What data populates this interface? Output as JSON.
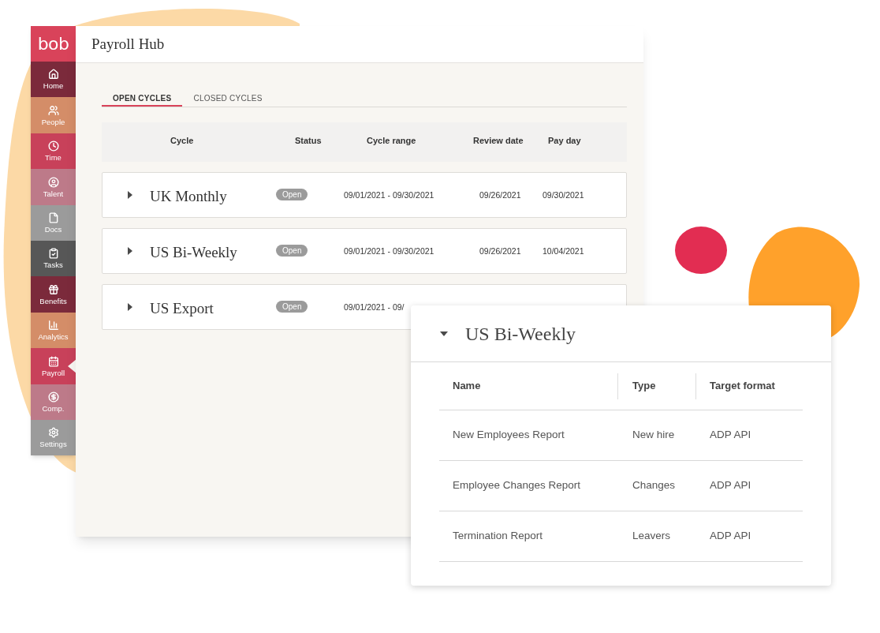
{
  "sidebar": {
    "logo": "bob",
    "items": [
      {
        "label": "Home",
        "color": "#7b2a3b",
        "selected": false
      },
      {
        "label": "People",
        "color": "#d48d68",
        "selected": false
      },
      {
        "label": "Time",
        "color": "#c8415a",
        "selected": false
      },
      {
        "label": "Talent",
        "color": "#bd7a89",
        "selected": false
      },
      {
        "label": "Docs",
        "color": "#9b9b9b",
        "selected": false
      },
      {
        "label": "Tasks",
        "color": "#575757",
        "selected": false
      },
      {
        "label": "Benefits",
        "color": "#7b2a3b",
        "selected": false
      },
      {
        "label": "Analytics",
        "color": "#d48d68",
        "selected": false
      },
      {
        "label": "Payroll",
        "color": "#c8415a",
        "selected": true
      },
      {
        "label": "Comp.",
        "color": "#bd7a89",
        "selected": false
      },
      {
        "label": "Settings",
        "color": "#9b9b9b",
        "selected": false
      }
    ]
  },
  "window": {
    "title": "Payroll Hub"
  },
  "tabs": [
    {
      "label": "OPEN CYCLES",
      "selected": true
    },
    {
      "label": "CLOSED CYCLES",
      "selected": false
    }
  ],
  "table": {
    "columns": [
      "Cycle",
      "Status",
      "Cycle range",
      "Review date",
      "Pay day"
    ],
    "rows": [
      {
        "cycle": "UK Monthly",
        "expanded": false,
        "status": "Open",
        "cycle_range": "09/01/2021 - 09/30/2021",
        "review_date": "09/26/2021",
        "pay_day": "09/30/2021"
      },
      {
        "cycle": "US Bi-Weekly",
        "expanded": false,
        "status": "Open",
        "cycle_range": "09/01/2021 - 09/30/2021",
        "review_date": "09/26/2021",
        "pay_day": "10/04/2021"
      },
      {
        "cycle": "US Export",
        "expanded": false,
        "status": "Open",
        "cycle_range": "09/01/2021 - 09/"
      }
    ]
  },
  "detail_panel": {
    "title": "US Bi-Weekly",
    "expanded": true,
    "columns": [
      "Name",
      "Type",
      "Target format"
    ],
    "rows": [
      {
        "name": "New Employees Report",
        "type": "New hire",
        "target_format": "ADP API"
      },
      {
        "name": "Employee Changes Report",
        "type": "Changes",
        "target_format": "ADP API"
      },
      {
        "name": "Termination Report",
        "type": "Leavers",
        "target_format": "ADP API"
      }
    ]
  }
}
